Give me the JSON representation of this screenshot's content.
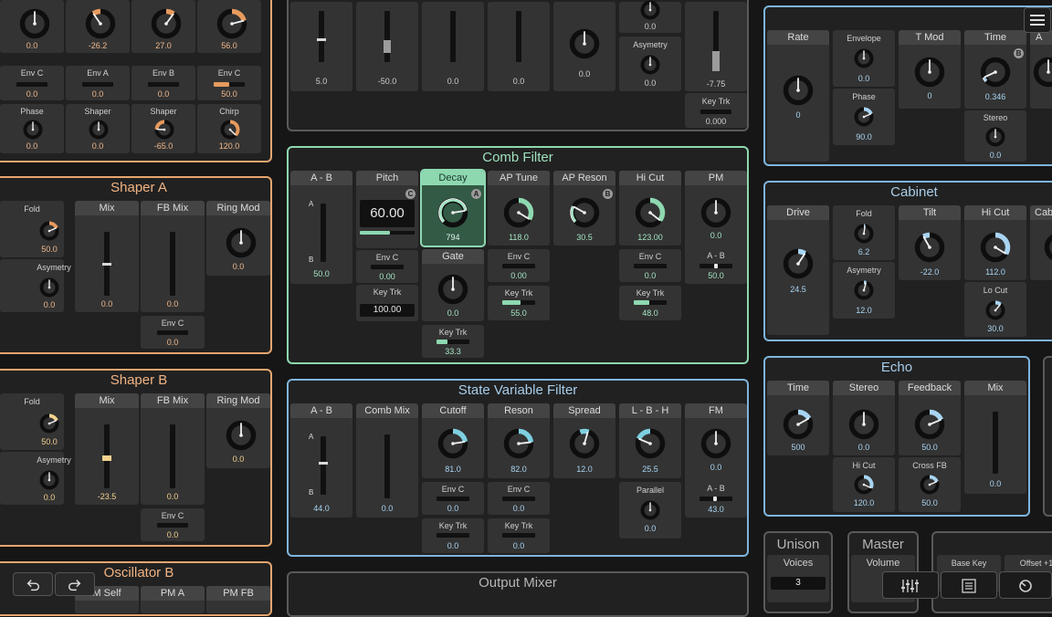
{
  "colors": {
    "orange": "#e6a56f",
    "green": "#8ed8b0",
    "blue": "#7eb5dc",
    "knob_track": "#0e0e0e"
  },
  "osc_top": {
    "row1_values": [
      "0.0",
      "-26.2",
      "27.0",
      "56.0"
    ],
    "row2": [
      {
        "label": "Env C",
        "value": "0.0"
      },
      {
        "label": "Env A",
        "value": "0.0"
      },
      {
        "label": "Env B",
        "value": "0.0"
      },
      {
        "label": "Env C",
        "value": "50.0"
      }
    ],
    "row3": [
      {
        "label": "Phase",
        "value": "0.0"
      },
      {
        "label": "Shaper",
        "value": "0.0"
      },
      {
        "label": "Shaper",
        "value": "-65.0"
      },
      {
        "label": "Chirp",
        "value": "120.0"
      }
    ]
  },
  "shaper_a": {
    "title": "Shaper A",
    "headers": {
      "mix": "Mix",
      "fbmix": "FB Mix",
      "ringmod": "Ring Mod"
    },
    "fold": {
      "label": "Fold",
      "value": "50.0"
    },
    "asym": {
      "label": "Asymetry",
      "value": "0.0"
    },
    "mix": "0.0",
    "fbmix": "0.0",
    "ringmod": "0.0",
    "envc": {
      "label": "Env C",
      "value": "0.0"
    }
  },
  "shaper_b": {
    "title": "Shaper B",
    "headers": {
      "mix": "Mix",
      "fbmix": "FB Mix",
      "ringmod": "Ring Mod"
    },
    "fold": {
      "label": "Fold",
      "value": "50.0"
    },
    "asym": {
      "label": "Asymetry",
      "value": "0.0"
    },
    "mix": "-23.5",
    "fbmix": "0.0",
    "ringmod": "0.0",
    "envc": {
      "label": "Env C",
      "value": "0.0"
    }
  },
  "osc_b": {
    "title": "Oscillator B",
    "headers": [
      "M Self",
      "PM A",
      "PM FB"
    ]
  },
  "top_mid": {
    "values": [
      "5.0",
      "-50.0",
      "0.0",
      "0.0",
      "0.0",
      "-7.75"
    ],
    "right_col": [
      {
        "label": "",
        "value": "0.0"
      },
      {
        "label": "Asymetry",
        "value": "0.0"
      }
    ],
    "keytrk": {
      "label": "Key Trk",
      "value": "0.000"
    }
  },
  "comb": {
    "title": "Comb Filter",
    "ab": {
      "header": "A - B",
      "a": "A",
      "b": "B",
      "value": "50.0"
    },
    "pitch": {
      "header": "Pitch",
      "display": "60.00",
      "badge": "C",
      "envc": "Env C",
      "envc_value": "0.00",
      "keytrk": "Key Trk",
      "keytrk_value": "100.00"
    },
    "decay": {
      "header": "Decay",
      "badge": "A",
      "value": "794"
    },
    "gate": {
      "header": "Gate",
      "value": "0.0",
      "keytrk": "Key Trk",
      "keytrk_value": "33.3"
    },
    "aptune": {
      "header": "AP Tune",
      "value": "118.0",
      "envc": "Env C",
      "envc_value": "0.00",
      "keytrk": "Key Trk",
      "keytrk_value": "55.0"
    },
    "apreson": {
      "header": "AP Reson",
      "badge": "B",
      "value": "30.5"
    },
    "hicut": {
      "header": "Hi Cut",
      "value": "123.00",
      "envc": "Env C",
      "envc_value": "0.0",
      "keytrk": "Key Trk",
      "keytrk_value": "48.0"
    },
    "pm": {
      "header": "PM",
      "value": "0.0",
      "ab": "A - B",
      "ab_value": "50.0"
    }
  },
  "svf": {
    "title": "State Variable Filter",
    "ab": {
      "header": "A - B",
      "a": "A",
      "b": "B",
      "value": "44.0"
    },
    "combmix": {
      "header": "Comb Mix",
      "value": "0.0"
    },
    "cutoff": {
      "header": "Cutoff",
      "value": "81.0",
      "envc": "Env C",
      "envc_value": "0.0",
      "keytrk": "Key Trk",
      "keytrk_value": "0.0"
    },
    "reson": {
      "header": "Reson",
      "value": "82.0",
      "envc": "Env C",
      "envc_value": "0.0",
      "keytrk": "Key Trk",
      "keytrk_value": "0.0"
    },
    "spread": {
      "header": "Spread",
      "value": "12.0"
    },
    "lbh": {
      "header": "L - B - H",
      "value": "25.5",
      "parallel": "Parallel",
      "parallel_value": "0.0"
    },
    "fm": {
      "header": "FM",
      "value": "0.0",
      "ab": "A - B",
      "ab_value": "43.0"
    }
  },
  "output_mixer": {
    "title": "Output Mixer"
  },
  "top_right": {
    "headers": [
      "Rate",
      "Envelope",
      "T Mod",
      "Time",
      "A"
    ],
    "rate": "0",
    "envelope": "0.0",
    "phase": {
      "label": "Phase",
      "value": "90.0"
    },
    "tmod": "0",
    "time": "0.346",
    "time_badge": "B",
    "stereo": {
      "label": "Stereo",
      "value": "0.0"
    }
  },
  "cabinet": {
    "title": "Cabinet",
    "headers": [
      "Drive",
      "Fold",
      "Tilt",
      "Hi Cut",
      "Cab"
    ],
    "drive": "24.5",
    "fold": "6.2",
    "asym": {
      "label": "Asymetry",
      "value": "12.0"
    },
    "tilt": "-22.0",
    "hicut": "112.0",
    "locut": {
      "label": "Lo Cut",
      "value": "30.0"
    }
  },
  "echo": {
    "title": "Echo",
    "headers": [
      "Time",
      "Stereo",
      "Feedback",
      "Mix"
    ],
    "time": "500",
    "stereo": "0.0",
    "feedback": "50.0",
    "mix": "0.0",
    "hicut": {
      "label": "Hi Cut",
      "value": "120.0"
    },
    "crossfb": {
      "label": "Cross FB",
      "value": "50.0"
    }
  },
  "unison": {
    "title": "Unison",
    "voices_label": "Voices",
    "voices": "3"
  },
  "master": {
    "title": "Master",
    "volume_label": "Volume"
  },
  "scale": {
    "base_key": "Base Key",
    "offset": "Offset +1"
  }
}
